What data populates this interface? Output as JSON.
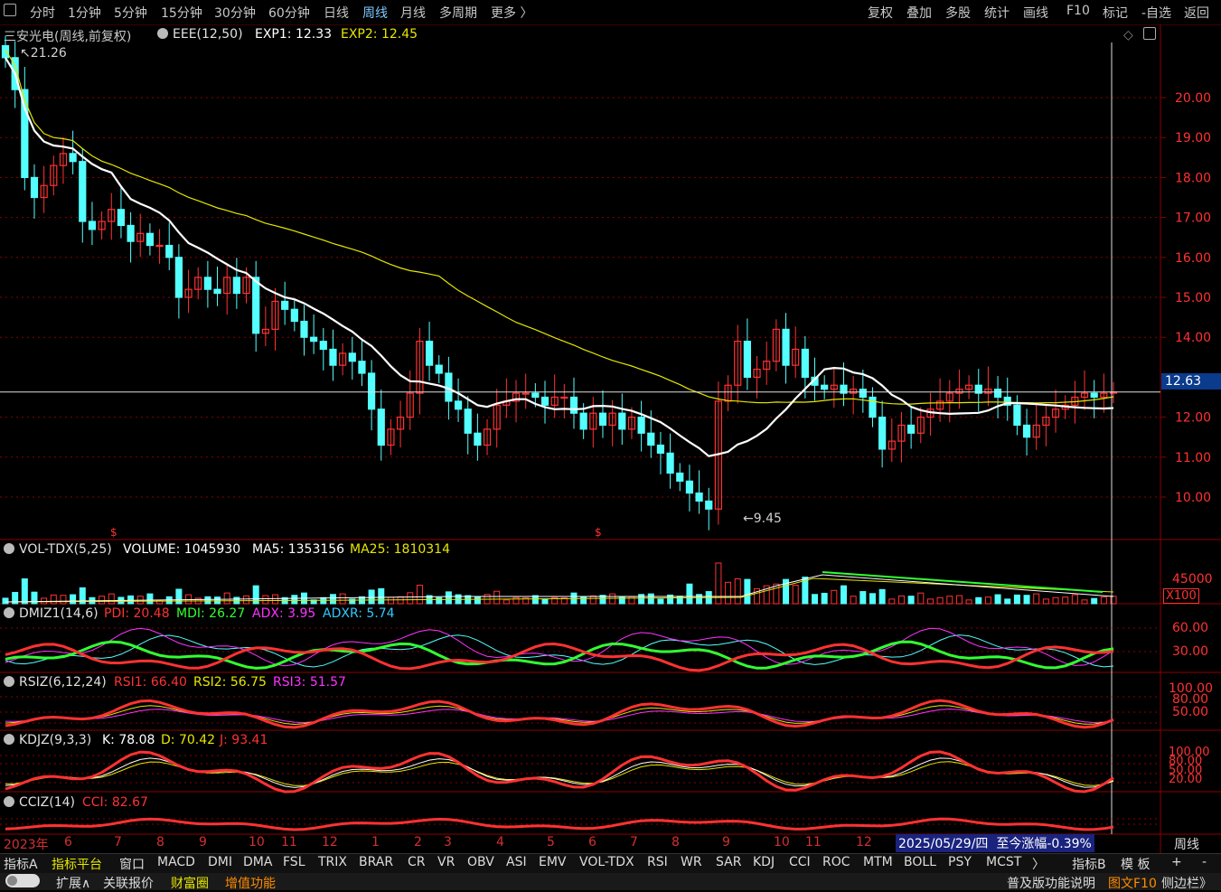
{
  "topbar": {
    "items": [
      "分时",
      "1分钟",
      "5分钟",
      "15分钟",
      "30分钟",
      "60分钟",
      "日线",
      "周线",
      "月线",
      "多周期",
      "更多 〉"
    ],
    "right_items": [
      "复权",
      "叠加",
      "多股",
      "统计",
      "画线",
      "F10",
      "标记",
      "-自选",
      "返回"
    ]
  },
  "main": {
    "title": "三安光电(周线,前复权)",
    "indicator": "EEE(12,50)",
    "exp1": "EXP1: 12.33",
    "exp2": "EXP2: 12.45",
    "high_label": "21.26",
    "low_label": "9.45",
    "current_price": "12.63",
    "price_ticks": [
      "20.00",
      "19.00",
      "18.00",
      "17.00",
      "16.00",
      "15.00",
      "14.00",
      "12.00",
      "11.00",
      "10.00"
    ]
  },
  "vol": {
    "name": "VOL-TDX(5,25)",
    "volume": "VOLUME: 1045930",
    "ma5": "MA5: 1353156",
    "ma25": "MA25: 1810314",
    "tick": "45000",
    "mult": "X100"
  },
  "dmi": {
    "name": "DMIZ1(14,6)",
    "pdi": "PDI: 20.48",
    "mdi": "MDI: 26.27",
    "adx": "ADX: 3.95",
    "adxr": "ADXR: 5.74",
    "ticks": [
      "60.00",
      "30.00"
    ]
  },
  "rsi": {
    "name": "RSIZ(6,12,24)",
    "rsi1": "RSI1: 66.40",
    "rsi2": "RSI2: 56.75",
    "rsi3": "RSI3: 51.57",
    "ticks": [
      "100.00",
      "80.00",
      "50.00"
    ]
  },
  "kdj": {
    "name": "KDJZ(9,3,3)",
    "k": "K: 78.08",
    "d": "D: 70.42",
    "j": "J: 93.41",
    "ticks": [
      "100.00",
      "80.00",
      "50.00",
      "20.00"
    ]
  },
  "cci": {
    "name": "CCIZ(14)",
    "cci": "CCI: 82.67"
  },
  "dates": {
    "year": "2023年",
    "months": [
      "6",
      "7",
      "8",
      "9",
      "10",
      "11",
      "12",
      "1",
      "2",
      "3",
      "4",
      "5",
      "6",
      "7",
      "8",
      "9",
      "10",
      "11",
      "12"
    ],
    "info_date": "2025/05/29/四",
    "info_change": "至今涨幅-0.39%",
    "period": "周线"
  },
  "tabs": {
    "items": [
      "指标A",
      "指标平台",
      "窗口",
      "MACD",
      "DMI",
      "DMA",
      "FSL",
      "TRIX",
      "BRAR",
      "CR",
      "VR",
      "OBV",
      "ASI",
      "EMV",
      "VOL-TDX",
      "RSI",
      "WR",
      "SAR",
      "KDJ",
      "CCI",
      "ROC",
      "MTM",
      "BOLL",
      "PSY",
      "MCST",
      "〉"
    ],
    "right": [
      "指标B",
      "模 板",
      "+",
      "-"
    ]
  },
  "bottom": {
    "items": [
      "扩展∧",
      "关联报价",
      "财富圈",
      "增值功能"
    ],
    "right": [
      "普及版功能说明",
      "图文F10",
      "侧边栏》"
    ]
  },
  "colors": {
    "up": "#ff3232",
    "down": "#54ffff",
    "ma1": "#ffffff",
    "ma2": "#e6e600",
    "grid": "#8b0000"
  }
}
